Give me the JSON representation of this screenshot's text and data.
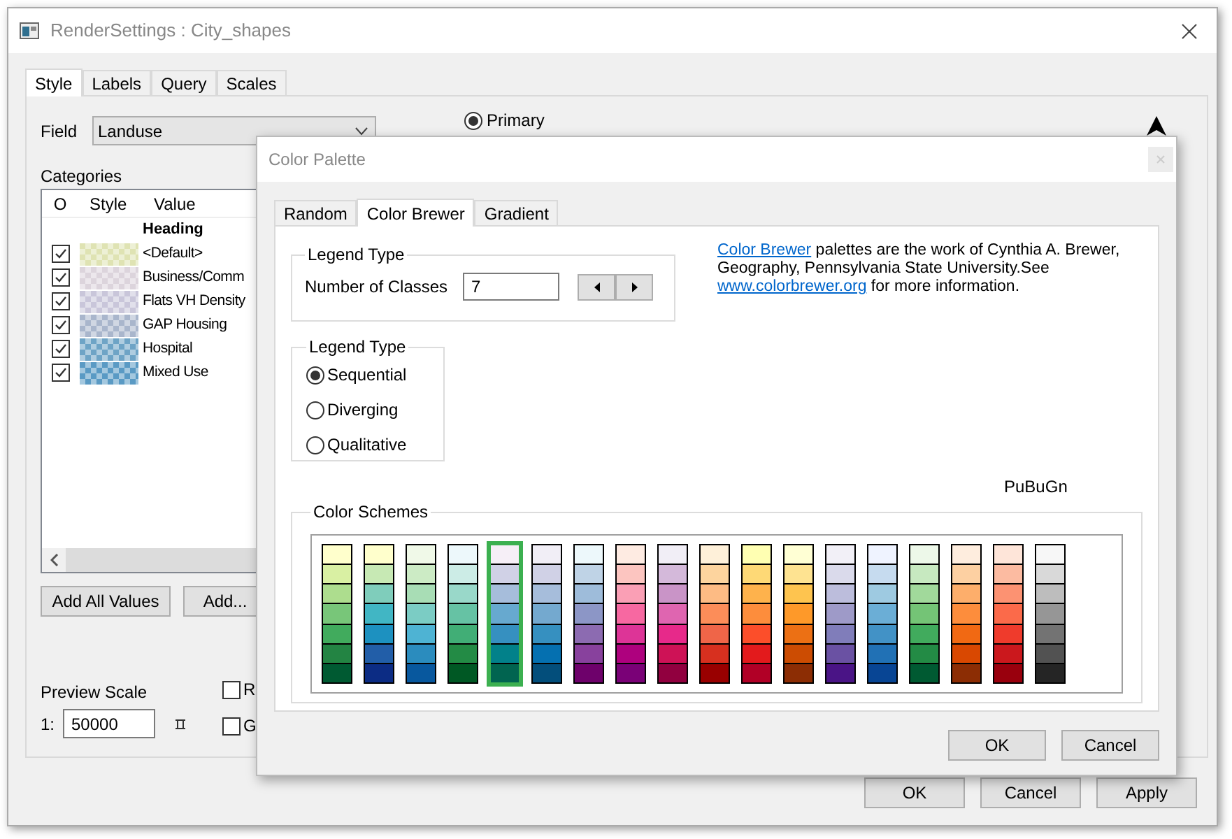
{
  "window": {
    "title": "RenderSettings : City_shapes",
    "tabs": [
      {
        "label": "Style",
        "selected": true
      },
      {
        "label": "Labels",
        "selected": false
      },
      {
        "label": "Query",
        "selected": false
      },
      {
        "label": "Scales",
        "selected": false
      }
    ],
    "field": {
      "label": "Field",
      "value": "Landuse"
    },
    "mode": {
      "label": "Primary",
      "selected": true
    },
    "categories": {
      "label": "Categories",
      "columns": [
        "O",
        "Style",
        "Value"
      ],
      "heading": "Heading",
      "rows": [
        {
          "value": "<Default>",
          "checked": true,
          "color": "#dfe3b3"
        },
        {
          "value": "Business/Comm",
          "checked": true,
          "color": "#dcd4dc"
        },
        {
          "value": "Flats VH Density",
          "checked": true,
          "color": "#c9c6da"
        },
        {
          "value": "GAP Housing",
          "checked": true,
          "color": "#a9b6cc"
        },
        {
          "value": "Hospital",
          "checked": true,
          "color": "#6ea4c6"
        },
        {
          "value": "Mixed Use",
          "checked": true,
          "color": "#5a9ac4"
        }
      ]
    },
    "list_buttons": [
      "Add All Values",
      "Add..."
    ],
    "preview": {
      "label": "Preview Scale",
      "prefix": "1:",
      "value": "50000"
    },
    "options": [
      {
        "label": "R",
        "checked": false
      },
      {
        "label": "G",
        "checked": false
      }
    ],
    "buttons": [
      "OK",
      "Cancel",
      "Apply"
    ]
  },
  "dialog": {
    "title": "Color Palette",
    "tabs": [
      {
        "label": "Random",
        "selected": false
      },
      {
        "label": "Color Brewer",
        "selected": true
      },
      {
        "label": "Gradient",
        "selected": false
      }
    ],
    "classes_group": {
      "title": "Legend Type",
      "label": "Number of Classes",
      "value": "7"
    },
    "type_group": {
      "title": "Legend Type",
      "options": [
        {
          "label": "Sequential",
          "selected": true
        },
        {
          "label": "Diverging",
          "selected": false
        },
        {
          "label": "Qualitative",
          "selected": false
        }
      ]
    },
    "description": [
      {
        "kind": "link",
        "text": "Color Brewer"
      },
      {
        "kind": "text",
        "text": " palettes are the work of Cynthia A. Brewer, Geography, Pennsylvania State University.See "
      },
      {
        "kind": "link",
        "text": "www.colorbrewer.org"
      },
      {
        "kind": "text",
        "text": " for more information."
      }
    ],
    "scheme_name": "PuBuGn",
    "schemes_title": "Color Schemes",
    "schemes": [
      {
        "selected": false,
        "swatches": [
          {
            "color": "#ffffcc"
          },
          {
            "color": "#d9f0a3"
          },
          {
            "color": "#addd8e"
          },
          {
            "color": "#78c679"
          },
          {
            "color": "#41ab5d"
          },
          {
            "color": "#238443"
          },
          {
            "color": "#005a32"
          }
        ]
      },
      {
        "selected": false,
        "swatches": [
          {
            "color": "#ffffcc"
          },
          {
            "color": "#c7e9b4"
          },
          {
            "color": "#7fcdbb"
          },
          {
            "color": "#41b6c4"
          },
          {
            "color": "#1d91c0"
          },
          {
            "color": "#225ea8"
          },
          {
            "color": "#0c2c84"
          }
        ]
      },
      {
        "selected": false,
        "swatches": [
          {
            "color": "#f0f9e8"
          },
          {
            "color": "#ccebc5"
          },
          {
            "color": "#a8ddb5"
          },
          {
            "color": "#7bccc4"
          },
          {
            "color": "#4eb3d3"
          },
          {
            "color": "#2b8cbe"
          },
          {
            "color": "#08589e"
          }
        ]
      },
      {
        "selected": false,
        "swatches": [
          {
            "color": "#edf8fb"
          },
          {
            "color": "#ccece6"
          },
          {
            "color": "#99d8c9"
          },
          {
            "color": "#66c2a4"
          },
          {
            "color": "#41ae76"
          },
          {
            "color": "#238b45"
          },
          {
            "color": "#005824"
          }
        ]
      },
      {
        "selected": true,
        "swatches": [
          {
            "color": "#f6eff7"
          },
          {
            "color": "#d0d1e6"
          },
          {
            "color": "#a6bddb"
          },
          {
            "color": "#67a9cf"
          },
          {
            "color": "#3690c0"
          },
          {
            "color": "#02818a"
          },
          {
            "color": "#016450"
          }
        ]
      },
      {
        "selected": false,
        "swatches": [
          {
            "color": "#f1eef6"
          },
          {
            "color": "#d0d1e6"
          },
          {
            "color": "#a6bddb"
          },
          {
            "color": "#74a9cf"
          },
          {
            "color": "#3690c0"
          },
          {
            "color": "#0570b0"
          },
          {
            "color": "#034e7b"
          }
        ]
      },
      {
        "selected": false,
        "swatches": [
          {
            "color": "#edf8fb"
          },
          {
            "color": "#bfd3e6"
          },
          {
            "color": "#9ebcda"
          },
          {
            "color": "#8c96c6"
          },
          {
            "color": "#8c6bb1"
          },
          {
            "color": "#88419d"
          },
          {
            "color": "#6e016b"
          }
        ]
      },
      {
        "selected": false,
        "swatches": [
          {
            "color": "#feebe2"
          },
          {
            "color": "#fcc5c0"
          },
          {
            "color": "#fa9fb5"
          },
          {
            "color": "#f768a1"
          },
          {
            "color": "#dd3497"
          },
          {
            "color": "#ae017e"
          },
          {
            "color": "#7a0177"
          }
        ]
      },
      {
        "selected": false,
        "swatches": [
          {
            "color": "#f1eef6"
          },
          {
            "color": "#d4b9da"
          },
          {
            "color": "#c994c7"
          },
          {
            "color": "#df65b0"
          },
          {
            "color": "#e7298a"
          },
          {
            "color": "#ce1256"
          },
          {
            "color": "#91003f"
          }
        ]
      },
      {
        "selected": false,
        "swatches": [
          {
            "color": "#fef0d9"
          },
          {
            "color": "#fdd49e"
          },
          {
            "color": "#fdbb84"
          },
          {
            "color": "#fc8d59"
          },
          {
            "color": "#ef6548"
          },
          {
            "color": "#d7301f"
          },
          {
            "color": "#990000"
          }
        ]
      },
      {
        "selected": false,
        "swatches": [
          {
            "color": "#ffffb2"
          },
          {
            "color": "#fed976"
          },
          {
            "color": "#feb24c"
          },
          {
            "color": "#fd8d3c"
          },
          {
            "color": "#fc4e2a"
          },
          {
            "color": "#e31a1c"
          },
          {
            "color": "#b10026"
          }
        ]
      },
      {
        "selected": false,
        "swatches": [
          {
            "color": "#ffffd4"
          },
          {
            "color": "#fee391"
          },
          {
            "color": "#fec44f"
          },
          {
            "color": "#fe9929"
          },
          {
            "color": "#ec7014"
          },
          {
            "color": "#cc4c02"
          },
          {
            "color": "#8c2d04"
          }
        ]
      },
      {
        "selected": false,
        "swatches": [
          {
            "color": "#f2f0f7"
          },
          {
            "color": "#dadaeb"
          },
          {
            "color": "#bcbddc"
          },
          {
            "color": "#9e9ac8"
          },
          {
            "color": "#807dba"
          },
          {
            "color": "#6a51a3"
          },
          {
            "color": "#4a1486"
          }
        ]
      },
      {
        "selected": false,
        "swatches": [
          {
            "color": "#eff3ff"
          },
          {
            "color": "#c6dbef"
          },
          {
            "color": "#9ecae1"
          },
          {
            "color": "#6baed6"
          },
          {
            "color": "#4292c6"
          },
          {
            "color": "#2171b5"
          },
          {
            "color": "#084594"
          }
        ]
      },
      {
        "selected": false,
        "swatches": [
          {
            "color": "#edf8e9"
          },
          {
            "color": "#c7e9c0"
          },
          {
            "color": "#a1d99b"
          },
          {
            "color": "#74c476"
          },
          {
            "color": "#41ab5d"
          },
          {
            "color": "#238b45"
          },
          {
            "color": "#005a32"
          }
        ]
      },
      {
        "selected": false,
        "swatches": [
          {
            "color": "#feedde"
          },
          {
            "color": "#fdd0a2"
          },
          {
            "color": "#fdae6b"
          },
          {
            "color": "#fd8d3c"
          },
          {
            "color": "#f16913"
          },
          {
            "color": "#d94801"
          },
          {
            "color": "#8c2d04"
          }
        ]
      },
      {
        "selected": false,
        "swatches": [
          {
            "color": "#fee5d9"
          },
          {
            "color": "#fcbba1"
          },
          {
            "color": "#fc9272"
          },
          {
            "color": "#fb6a4a"
          },
          {
            "color": "#ef3b2c"
          },
          {
            "color": "#cb181d"
          },
          {
            "color": "#99000d"
          }
        ]
      },
      {
        "selected": false,
        "swatches": [
          {
            "color": "#f7f7f7"
          },
          {
            "color": "#d9d9d9"
          },
          {
            "color": "#bdbdbd"
          },
          {
            "color": "#969696"
          },
          {
            "color": "#737373"
          },
          {
            "color": "#525252"
          },
          {
            "color": "#252525"
          }
        ]
      }
    ],
    "buttons": [
      "OK",
      "Cancel"
    ]
  }
}
